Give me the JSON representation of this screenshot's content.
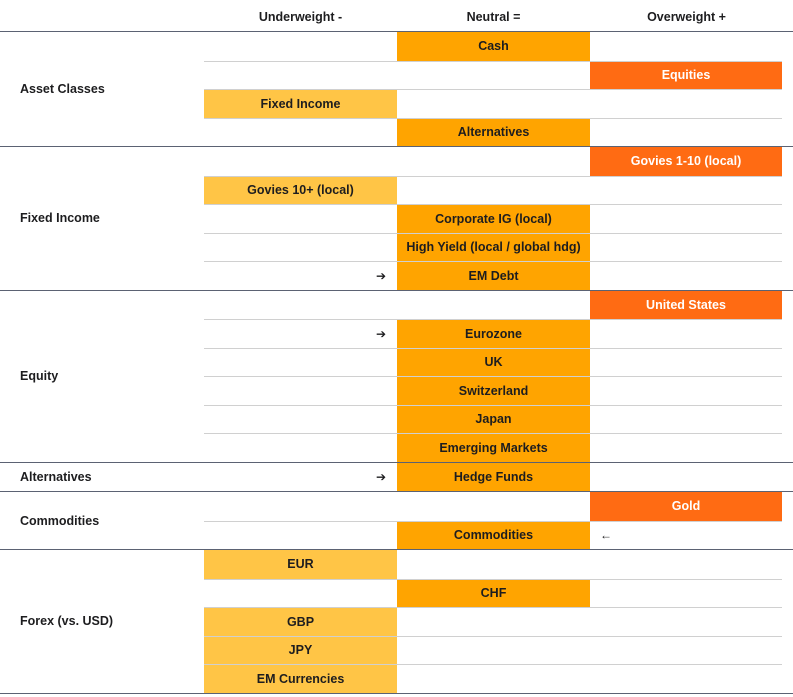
{
  "chart_data": {
    "type": "table",
    "title": "",
    "columns": [
      "Underweight -",
      "Neutral =",
      "Overweight +"
    ],
    "colors": {
      "underweight": "#ffc546",
      "neutral": "#ffa400",
      "overweight": "#ff6b13"
    },
    "sections": [
      {
        "label": "Asset Classes",
        "rows": [
          {
            "name": "Cash",
            "position": "neutral",
            "arrow": null
          },
          {
            "name": "Equities",
            "position": "overweight",
            "arrow": null
          },
          {
            "name": "Fixed Income",
            "position": "underweight",
            "arrow": null
          },
          {
            "name": "Alternatives",
            "position": "neutral",
            "arrow": null
          }
        ]
      },
      {
        "label": "Fixed Income",
        "rows": [
          {
            "name": "Govies 1-10 (local)",
            "position": "overweight",
            "arrow": null
          },
          {
            "name": "Govies 10+ (local)",
            "position": "underweight",
            "arrow": null
          },
          {
            "name": "Corporate IG (local)",
            "position": "neutral",
            "arrow": null
          },
          {
            "name": "High Yield (local / global hdg)",
            "position": "neutral",
            "arrow": null
          },
          {
            "name": "EM Debt",
            "position": "neutral",
            "arrow": "up-from-underweight"
          }
        ]
      },
      {
        "label": "Equity",
        "rows": [
          {
            "name": "United States",
            "position": "overweight",
            "arrow": null
          },
          {
            "name": "Eurozone",
            "position": "neutral",
            "arrow": "up-from-underweight"
          },
          {
            "name": "UK",
            "position": "neutral",
            "arrow": null
          },
          {
            "name": "Switzerland",
            "position": "neutral",
            "arrow": null
          },
          {
            "name": "Japan",
            "position": "neutral",
            "arrow": null
          },
          {
            "name": "Emerging Markets",
            "position": "neutral",
            "arrow": null
          }
        ]
      },
      {
        "label": "Alternatives",
        "rows": [
          {
            "name": "Hedge Funds",
            "position": "neutral",
            "arrow": "up-from-underweight"
          }
        ]
      },
      {
        "label": "Commodities",
        "rows": [
          {
            "name": "Gold",
            "position": "overweight",
            "arrow": null
          },
          {
            "name": "Commodities",
            "position": "neutral",
            "arrow": "down-from-overweight"
          }
        ]
      },
      {
        "label": "Forex (vs. USD)",
        "rows": [
          {
            "name": "EUR",
            "position": "underweight",
            "arrow": null
          },
          {
            "name": "CHF",
            "position": "neutral",
            "arrow": null
          },
          {
            "name": "GBP",
            "position": "underweight",
            "arrow": null
          },
          {
            "name": "JPY",
            "position": "underweight",
            "arrow": null
          },
          {
            "name": "EM Currencies",
            "position": "underweight",
            "arrow": null
          }
        ]
      }
    ]
  },
  "header": {
    "underweight": "Underweight -",
    "neutral": "Neutral =",
    "overweight": "Overweight +"
  },
  "arrows": {
    "right": "➔",
    "left": "🡐"
  }
}
